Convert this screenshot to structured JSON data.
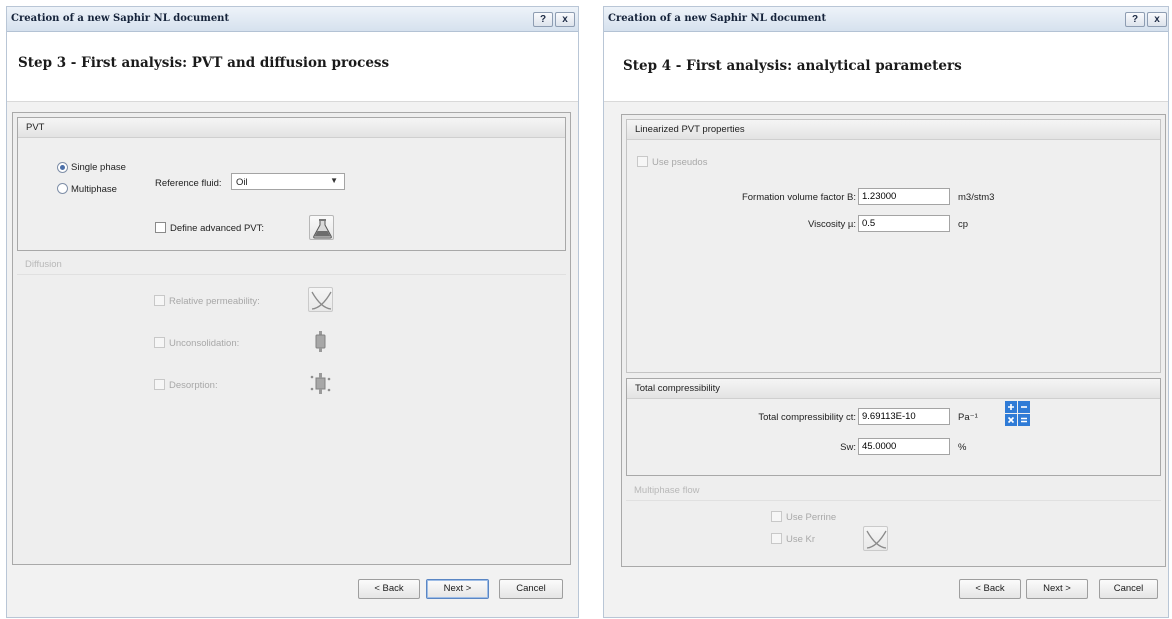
{
  "left_dialog": {
    "title": "Creation of a new Saphir NL document",
    "help_label": "?",
    "close_label": "x",
    "step_title": "Step 3 - First analysis: PVT and diffusion process",
    "pvt_group": {
      "header": "PVT",
      "single_phase_label": "Single phase",
      "multiphase_label": "Multiphase",
      "selected_phase": "Single phase",
      "reference_fluid_label": "Reference fluid:",
      "reference_fluid_value": "Oil",
      "advanced_pvt_label": "Define advanced PVT:",
      "advanced_pvt_icon": "flask-icon"
    },
    "diffusion_group": {
      "header": "Diffusion",
      "relative_permeability_label": "Relative permeability:",
      "relative_permeability_icon": "curves-icon",
      "unconsolidation_label": "Unconsolidation:",
      "unconsolidation_icon": "core-sample-icon",
      "desorption_label": "Desorption:",
      "desorption_icon": "desorption-icon"
    },
    "buttons": {
      "back": "< Back",
      "next": "Next >",
      "cancel": "Cancel"
    }
  },
  "right_dialog": {
    "title": "Creation of a new Saphir NL document",
    "help_label": "?",
    "close_label": "x",
    "step_title": "Step 4 - First analysis: analytical parameters",
    "linearized_group": {
      "header": "Linearized PVT properties",
      "use_pseudos_label": "Use pseudos",
      "fvf_label": "Formation volume factor B:",
      "fvf_value": "1.23000",
      "fvf_unit": "m3/stm3",
      "viscosity_label": "Viscosity µ:",
      "viscosity_value": "0.5",
      "viscosity_unit": "cp"
    },
    "compressibility_group": {
      "header": "Total compressibility",
      "ct_label": "Total compressibility ct:",
      "ct_value": "9.69113E-10",
      "ct_unit": "Pa⁻¹",
      "sw_label": "Sw:",
      "sw_value": "45.0000",
      "sw_unit": "%"
    },
    "multiphase_group": {
      "header": "Multiphase flow",
      "use_perrine_label": "Use Perrine",
      "use_kr_label": "Use Kr",
      "kr_icon": "curves-icon"
    },
    "buttons": {
      "back": "< Back",
      "next": "Next >",
      "cancel": "Cancel"
    }
  },
  "colors": {
    "accent": "#4b6fa9",
    "calc_blue": "#2f7bd6",
    "titlebar": "#d6e1ee"
  }
}
